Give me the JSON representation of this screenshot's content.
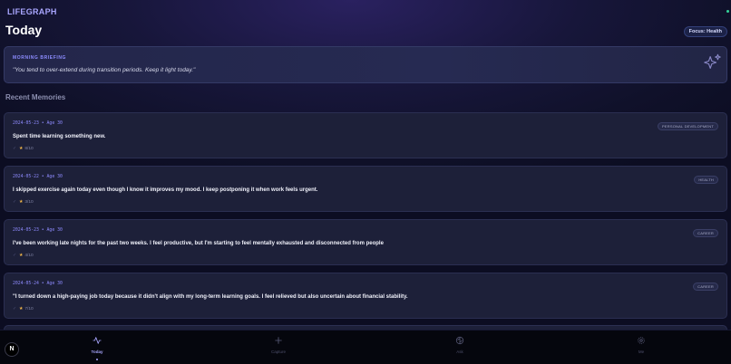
{
  "app": {
    "name": "LIFEGRAPH"
  },
  "page": {
    "title": "Today",
    "focus_badge": "Focus: Health"
  },
  "briefing": {
    "label": "MORNING BRIEFING",
    "quote": "\"You tend to over-extend during transition periods. Keep it light today.\""
  },
  "memories": {
    "section_title": "Recent Memories",
    "items": [
      {
        "date": "2024-05-23 • Age 30",
        "text": "Spent time learning something new.",
        "rating": "8/10",
        "tag": "PERSONAL DEVELOPMENT"
      },
      {
        "date": "2024-05-22 • Age 30",
        "text": "I skipped exercise again today even though I know it improves my mood. I keep postponing it when work feels urgent.",
        "rating": "3/10",
        "tag": "HEALTH"
      },
      {
        "date": "2024-05-23 • Age 30",
        "text": "I've been working late nights for the past two weeks. I feel productive, but I'm starting to feel mentally exhausted and disconnected from people",
        "rating": "4/10",
        "tag": "CAREER"
      },
      {
        "date": "2024-05-24 • Age 30",
        "text": "\"I turned down a high-paying job today because it didn't align with my long-term learning goals. I feel relieved but also uncertain about financial stability.",
        "rating": "7/10",
        "tag": "CAREER"
      }
    ]
  },
  "nav": {
    "items": [
      {
        "label": "Today",
        "icon": "activity-icon",
        "active": true
      },
      {
        "label": "Capture",
        "icon": "plus-icon",
        "active": false
      },
      {
        "label": "Ask",
        "icon": "brain-icon",
        "active": false
      },
      {
        "label": "Me",
        "icon": "settings-icon",
        "active": false
      }
    ]
  },
  "fab": {
    "label": "N"
  },
  "colors": {
    "accent": "#a9a6ff",
    "star": "#f5b94a",
    "status": "#34d399"
  }
}
